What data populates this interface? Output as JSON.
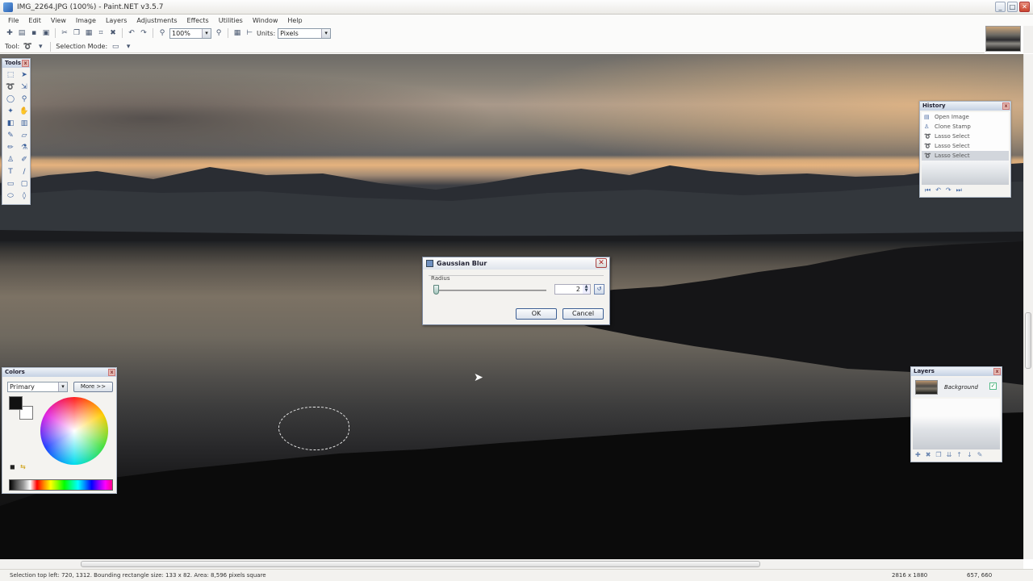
{
  "window": {
    "title": "IMG_2264.JPG (100%) - Paint.NET v3.5.7",
    "minimize": "_",
    "maximize": "□",
    "close": "✕"
  },
  "menu": [
    "File",
    "Edit",
    "View",
    "Image",
    "Layers",
    "Adjustments",
    "Effects",
    "Utilities",
    "Window",
    "Help"
  ],
  "toolbar": {
    "zoom_value": "100%",
    "units_label": "Units:",
    "units_value": "Pixels",
    "tool_label": "Tool:",
    "selection_mode_label": "Selection Mode:"
  },
  "tools_panel": {
    "title": "Tools",
    "tools": [
      "rectangle-select",
      "move-selected",
      "lasso-select",
      "move-selection",
      "ellipse-select",
      "zoom",
      "magic-wand",
      "pan",
      "paint-bucket",
      "gradient",
      "paintbrush",
      "eraser",
      "pencil",
      "color-picker",
      "clone-stamp",
      "recolor",
      "text",
      "line-curve",
      "rectangle",
      "rounded-rectangle",
      "ellipse",
      "freeform-shape"
    ]
  },
  "colors_panel": {
    "title": "Colors",
    "mode_value": "Primary",
    "more_button": "More >>"
  },
  "history_panel": {
    "title": "History",
    "items": [
      {
        "label": "Open Image",
        "selected": false
      },
      {
        "label": "Clone Stamp",
        "selected": false
      },
      {
        "label": "Lasso Select",
        "selected": false
      },
      {
        "label": "Lasso Select",
        "selected": false
      },
      {
        "label": "Lasso Select",
        "selected": true
      }
    ]
  },
  "layers_panel": {
    "title": "Layers",
    "layers": [
      {
        "name": "Background",
        "visible": true
      }
    ]
  },
  "dialog": {
    "title": "Gaussian Blur",
    "radius_label": "Radius",
    "radius_value": "2",
    "ok_label": "OK",
    "cancel_label": "Cancel"
  },
  "status": {
    "text": "Selection top left: 720, 1312. Bounding rectangle size: 133 x 82. Area: 8,596 pixels square",
    "image_size": "2816 x 1880",
    "cursor_position": "657, 660"
  },
  "colors": {
    "accent": "#3c5f94",
    "panel_bg": "#f4f3f0"
  }
}
